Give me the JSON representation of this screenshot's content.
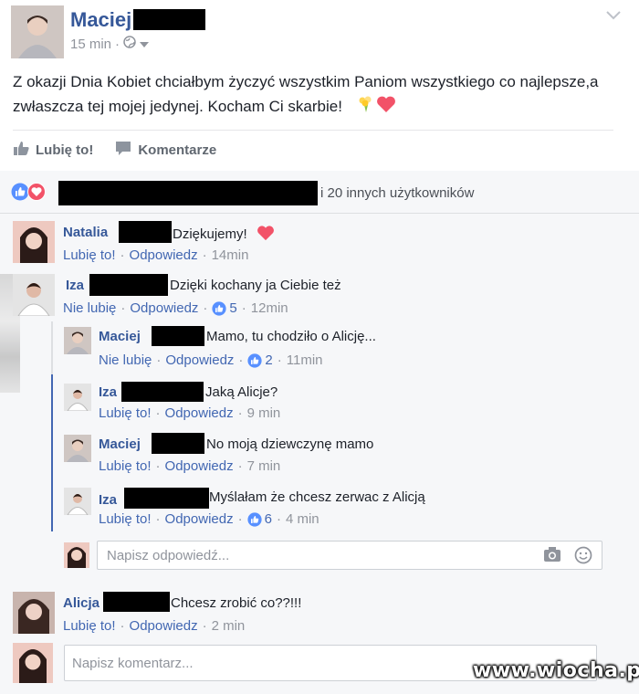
{
  "post": {
    "author": "Maciej",
    "time": "15 min",
    "text": "Z okazji Dnia Kobiet chciałbym życzyć wszystkim Paniom wszystkiego co najlepsze,a zwłaszcza tej mojej jedynej. Kocham Ci skarbie!",
    "like_label": "Lubię to!",
    "comment_label": "Komentarze"
  },
  "reactions": {
    "others_text": "i 20 innych użytkowników"
  },
  "comments": [
    {
      "author": "Natalia",
      "text": "Dziękujemy!",
      "like": "Lubię to!",
      "reply": "Odpowiedz",
      "time": "14min"
    },
    {
      "author": "Iza",
      "text": "Dzięki kochany ja Ciebie też",
      "like": "Nie lubię",
      "reply": "Odpowiedz",
      "likes": "5",
      "time": "12min"
    }
  ],
  "replies": [
    {
      "author": "Maciej",
      "text": "Mamo, tu chodziło o Alicję...",
      "like": "Nie lubię",
      "reply": "Odpowiedz",
      "likes": "2",
      "time": "11min"
    },
    {
      "author": "Iza",
      "text": "Jaką Alicje?",
      "like": "Lubię to!",
      "reply": "Odpowiedz",
      "time": "9 min"
    },
    {
      "author": "Maciej",
      "text": "No moją dziewczynę mamo",
      "like": "Lubię to!",
      "reply": "Odpowiedz",
      "time": "7 min"
    },
    {
      "author": "Iza",
      "text": "Myślałam że chcesz zerwac z Alicją",
      "like": "Lubię to!",
      "reply": "Odpowiedz",
      "likes": "6",
      "time": "4 min"
    }
  ],
  "reply_input": {
    "placeholder": "Napisz odpowiedź..."
  },
  "comment3": {
    "author": "Alicja",
    "text": "Chcesz zrobić co??!!!",
    "like": "Lubię to!",
    "reply": "Odpowiedz",
    "time": "2 min"
  },
  "comment_input": {
    "placeholder": "Napisz komentarz..."
  },
  "watermark": "www.wiocha.pl",
  "colors": {
    "link": "#4267b2",
    "name": "#365899",
    "heart": "#f25268",
    "like_blue": "#5890ff"
  }
}
